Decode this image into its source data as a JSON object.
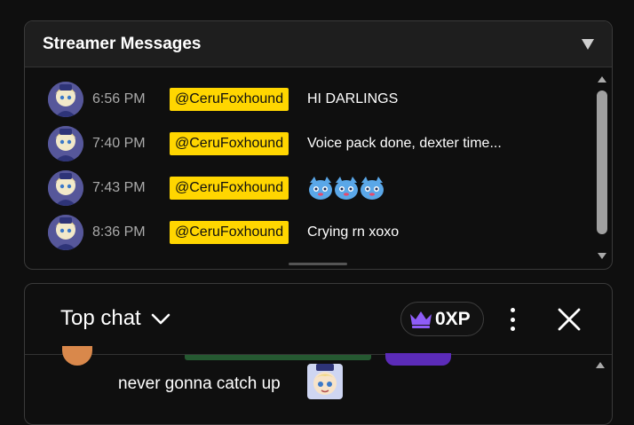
{
  "streamer_messages": {
    "title": "Streamer Messages",
    "messages": [
      {
        "time": "6:56 PM",
        "author": "@CeruFoxhound",
        "text": "HI DARLINGS"
      },
      {
        "time": "7:40 PM",
        "author": "@CeruFoxhound",
        "text": "Voice pack done, dexter time..."
      },
      {
        "time": "7:43 PM",
        "author": "@CeruFoxhound",
        "text": ""
      },
      {
        "time": "8:36 PM",
        "author": "@CeruFoxhound",
        "text": "Crying rn xoxo"
      }
    ],
    "emote_icon": "blue-cat-emote-icon"
  },
  "top_chat": {
    "title": "Top chat",
    "xp_label": "0XP",
    "last_message": "never gonna catch up"
  },
  "colors": {
    "author_chip": "#ffd600",
    "crown": "#8e5cf7",
    "background": "#0f0f0f"
  }
}
